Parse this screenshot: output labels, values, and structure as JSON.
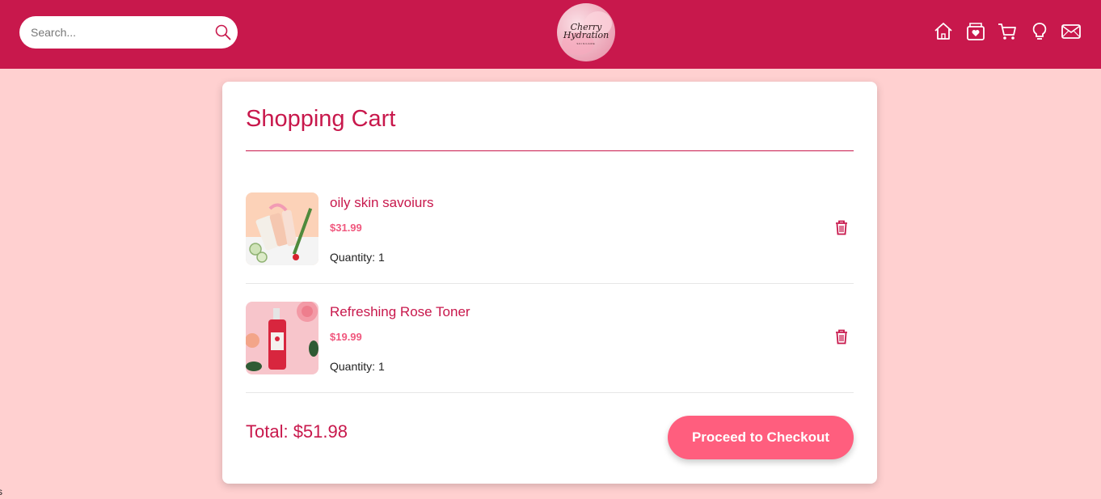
{
  "header": {
    "search": {
      "placeholder": "Search...",
      "value": ""
    },
    "logo": {
      "name": "Cherry\nHydration",
      "tagline": "SKINCARE"
    },
    "nav": [
      "home-icon",
      "store-heart-icon",
      "cart-icon",
      "lightbulb-icon",
      "mail-icon"
    ]
  },
  "cart": {
    "title": "Shopping Cart",
    "items": [
      {
        "name": "oily skin savoiurs",
        "price": "$31.99",
        "quantity_label": "Quantity:",
        "quantity": "1"
      },
      {
        "name": "Refreshing Rose Toner",
        "price": "$19.99",
        "quantity_label": "Quantity:",
        "quantity": "1"
      }
    ],
    "total_label": "Total: $51.98",
    "checkout_label": "Proceed to Checkout"
  },
  "stray_text": "s",
  "colors": {
    "brand": "#c8184c",
    "accent": "#ff5e7e",
    "background": "#ffd0d0",
    "price": "#f0587e"
  }
}
